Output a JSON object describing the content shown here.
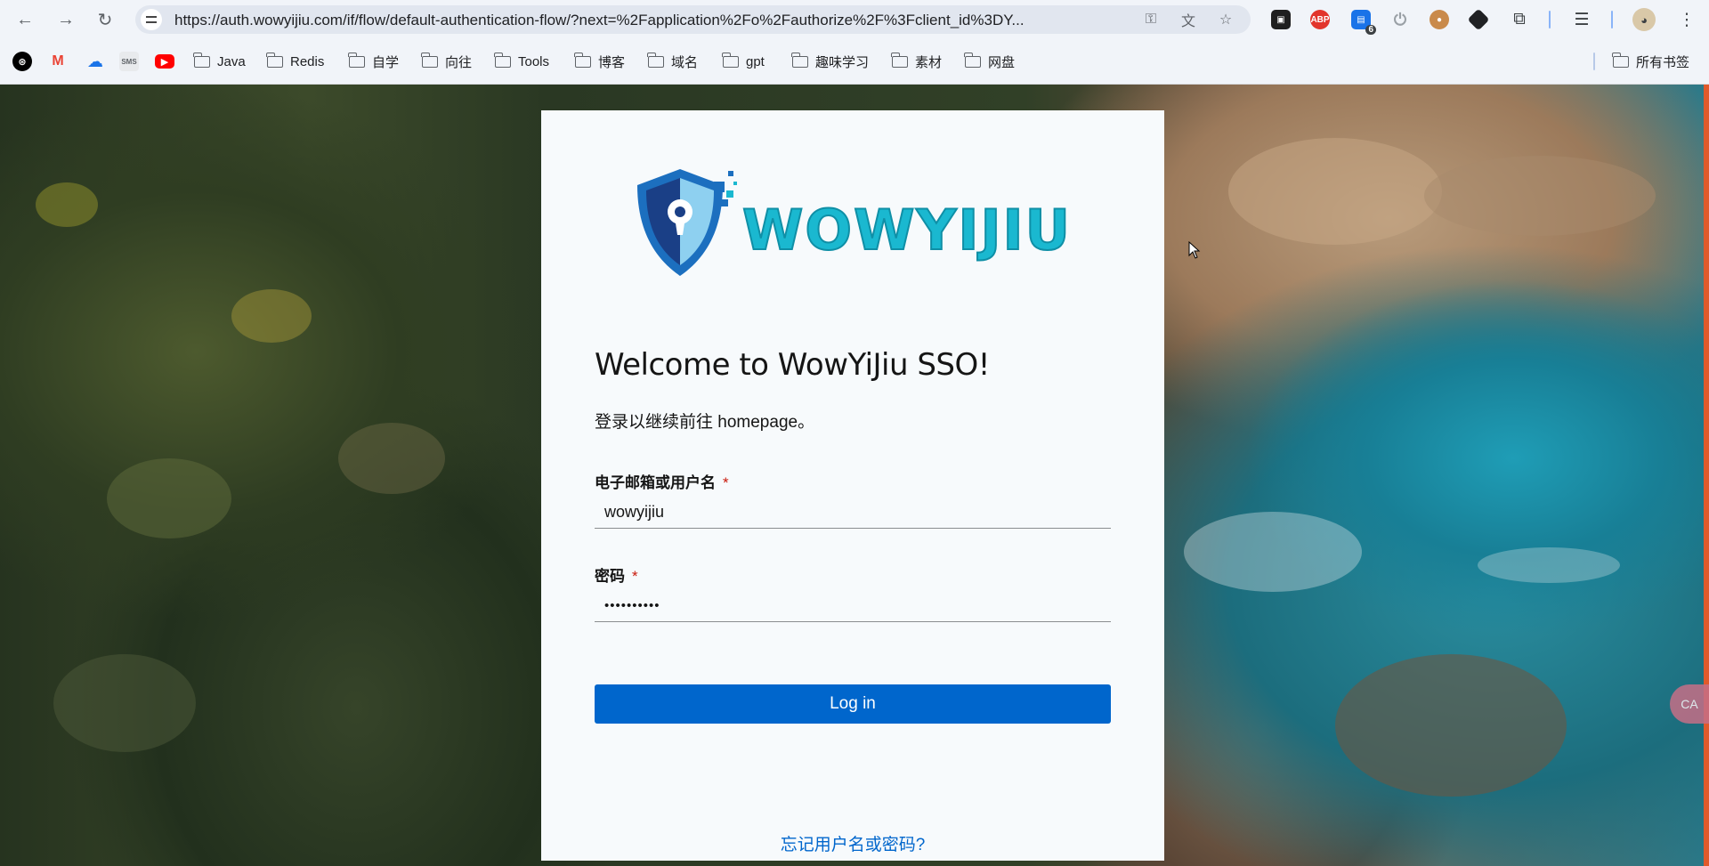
{
  "browser": {
    "url": "https://auth.wowyijiu.com/if/flow/default-authentication-flow/?next=%2Fapplication%2Fo%2Fauthorize%2F%3Fclient_id%3DY...",
    "extensions": [
      {
        "name": "tab-manager",
        "label": "",
        "color": "#1f1f1f"
      },
      {
        "name": "adblock",
        "label": "ABP",
        "color": "#e2352c"
      },
      {
        "name": "calendar-ext",
        "label": "",
        "color": "#1a73e8"
      },
      {
        "name": "power-ext",
        "label": "⏻",
        "color": "#9aa0a6"
      },
      {
        "name": "cookie-ext",
        "label": "",
        "color": "#a0622d"
      },
      {
        "name": "shield-ext",
        "label": "",
        "color": "#202124"
      }
    ],
    "calendar_badge": "6"
  },
  "bookmarks": {
    "items": [
      {
        "label": "Java",
        "type": "folder"
      },
      {
        "label": "Redis",
        "type": "folder"
      },
      {
        "label": "自学",
        "type": "folder"
      },
      {
        "label": "向往",
        "type": "folder"
      },
      {
        "label": "Tools",
        "type": "folder"
      },
      {
        "label": "博客",
        "type": "folder"
      },
      {
        "label": "域名",
        "type": "folder"
      },
      {
        "label": "gpt",
        "type": "folder"
      },
      {
        "label": "趣味学习",
        "type": "folder"
      },
      {
        "label": "素材",
        "type": "folder"
      },
      {
        "label": "网盘",
        "type": "folder"
      }
    ],
    "all_bookmarks": "所有书签",
    "favicons": [
      {
        "name": "openai-favicon",
        "label": "⊛",
        "bg": "#000000",
        "fg": "#ffffff"
      },
      {
        "name": "gmail-favicon",
        "label": "M",
        "bg": "#ffffff",
        "fg": "#ea4335"
      },
      {
        "name": "cloud-favicon",
        "label": "☁",
        "bg": "#ffffff",
        "fg": "#1a73e8"
      },
      {
        "name": "sms-favicon",
        "label": "SMS",
        "bg": "#e8eaed",
        "fg": "#5f6368"
      },
      {
        "name": "youtube-favicon",
        "label": "▶",
        "bg": "#ff0000",
        "fg": "#ffffff"
      }
    ]
  },
  "login": {
    "brand": "WOWYIJIU",
    "title": "Welcome to WowYiJiu SSO!",
    "subtitle": "登录以继续前往 homepage。",
    "username_label": "电子邮箱或用户名",
    "username_value": "wowyijiu",
    "password_label": "密码",
    "password_value": "••••••••••",
    "required_mark": "*",
    "login_button": "Log in",
    "forgot_link": "忘记用户名或密码?"
  },
  "colors": {
    "primary": "#0066cc",
    "required": "#c9190b",
    "brand_cyan": "#1ab8d0",
    "shield_blue": "#1c6fbf"
  },
  "floating_button_label": "CA"
}
